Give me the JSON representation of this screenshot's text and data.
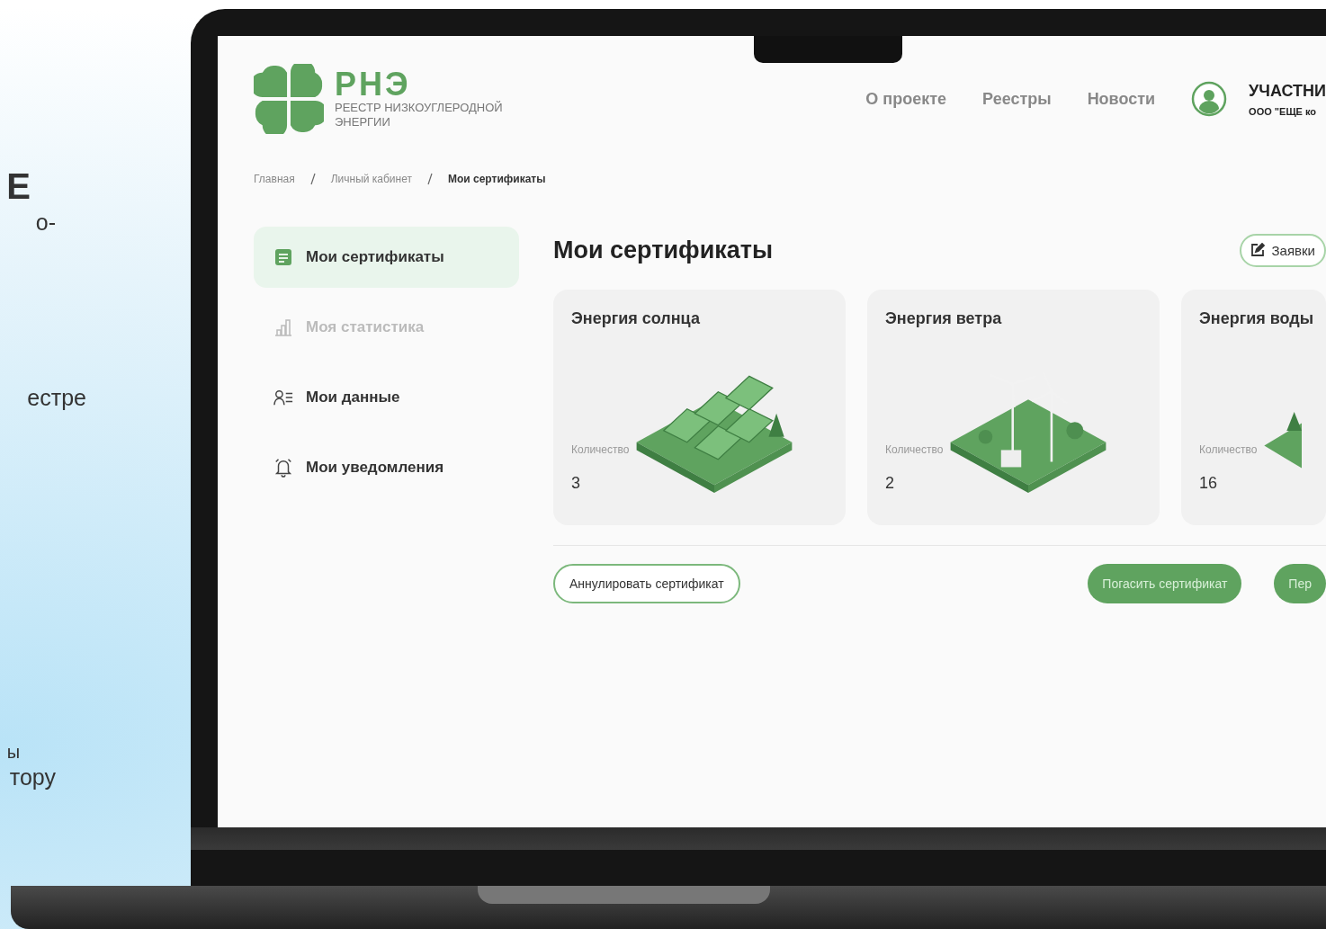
{
  "background_text": [
    {
      "text": "Е",
      "kind": "heading"
    },
    {
      "text": "о-",
      "kind": "body"
    },
    {
      "text": "естре",
      "kind": "body"
    },
    {
      "text": "ы",
      "kind": "small"
    },
    {
      "text": "тору",
      "kind": "body"
    }
  ],
  "header": {
    "logo_title": "РНЭ",
    "logo_subtitle": "РЕЕСТР НИЗКОУГЛЕРОДНОЙ ЭНЕРГИИ",
    "nav": [
      "О проекте",
      "Реестры",
      "Новости"
    ],
    "user": {
      "role": "УЧАСТНИ",
      "org": "ООО \"ЕЩЕ ко"
    }
  },
  "breadcrumbs": [
    {
      "label": "Главная",
      "current": false
    },
    {
      "label": "Личный кабинет",
      "current": false
    },
    {
      "label": "Мои сертификаты",
      "current": true
    }
  ],
  "sidebar": {
    "items": [
      {
        "label": "Мои сертификаты",
        "kind": "certificates",
        "selected": true,
        "disabled": false
      },
      {
        "label": "Моя статистика",
        "kind": "statistics",
        "selected": false,
        "disabled": true
      },
      {
        "label": "Мои данные",
        "kind": "data",
        "selected": false,
        "disabled": false
      },
      {
        "label": "Мои уведомления",
        "kind": "notifications",
        "selected": false,
        "disabled": false
      }
    ]
  },
  "page_title": "Мои сертификаты",
  "requests_button": "Заявки",
  "cards": [
    {
      "title": "Энергия солнца",
      "quantity_label": "Количество",
      "quantity": "3",
      "kind": "solar"
    },
    {
      "title": "Энергия ветра",
      "quantity_label": "Количество",
      "quantity": "2",
      "kind": "wind"
    },
    {
      "title": "Энергия воды",
      "quantity_label": "Количество",
      "quantity": "16",
      "kind": "water"
    }
  ],
  "actions": [
    {
      "label": "Аннулировать сертификат",
      "kind": "outline"
    },
    {
      "label": "Погасить сертификат",
      "kind": "filled"
    },
    {
      "label": "Пер",
      "kind": "filled"
    }
  ]
}
